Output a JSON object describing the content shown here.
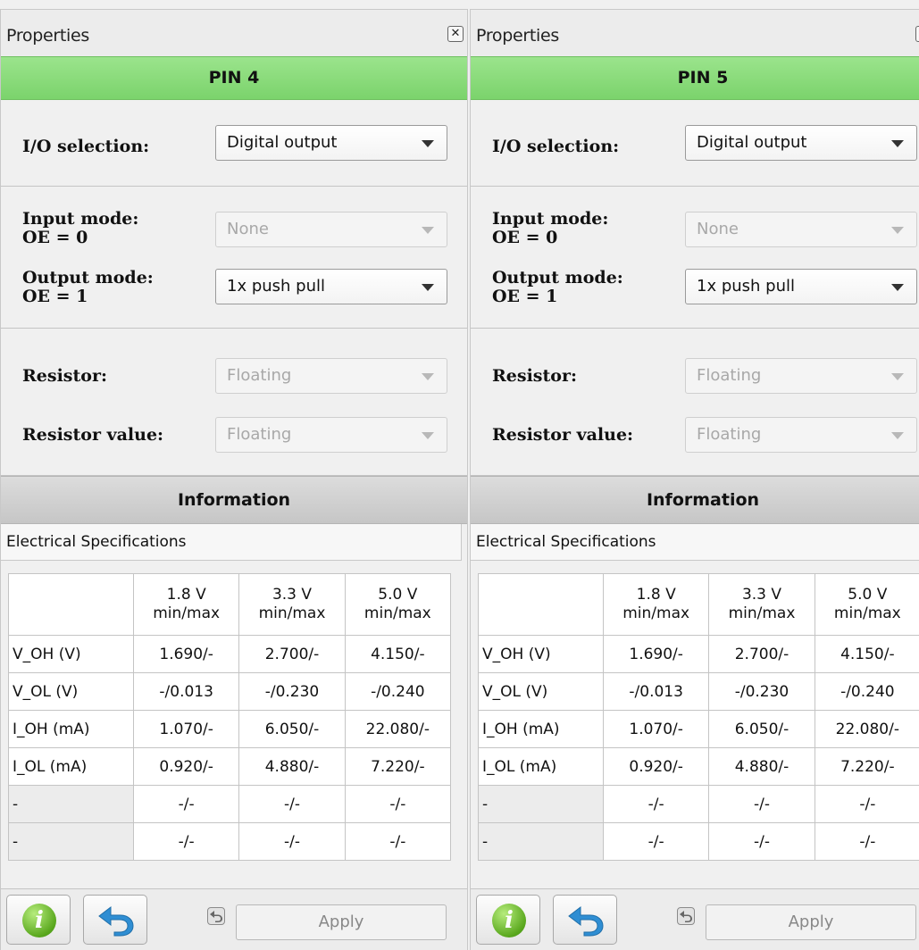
{
  "colors": {
    "pin_header": "#86da76",
    "info_header": "#d0d0d0",
    "info_icon": "#5aa81e",
    "undo_icon": "#2f8ed3"
  },
  "panels": [
    {
      "title": "Properties",
      "close_glyph": "✕",
      "pin": "PIN 4",
      "io_label": "I/O selection:",
      "io_value": "Digital output",
      "input_mode_label_1": "Input mode:",
      "input_mode_label_2": "OE = 0",
      "input_mode_value": "None",
      "output_mode_label_1": "Output mode:",
      "output_mode_label_2": "OE = 1",
      "output_mode_value": "1x push pull",
      "resistor_label": "Resistor:",
      "resistor_value": "Floating",
      "resistor_value_label": "Resistor value:",
      "resistor_value_value": "Floating",
      "info_header": "Information",
      "spec_title": "Electrical Specifications",
      "apply_label": "Apply"
    },
    {
      "title": "Properties",
      "close_glyph": "✕",
      "pin": "PIN 5",
      "io_label": "I/O selection:",
      "io_value": "Digital output",
      "input_mode_label_1": "Input mode:",
      "input_mode_label_2": "OE = 0",
      "input_mode_value": "None",
      "output_mode_label_1": "Output mode:",
      "output_mode_label_2": "OE = 1",
      "output_mode_value": "1x push pull",
      "resistor_label": "Resistor:",
      "resistor_value": "Floating",
      "resistor_value_label": "Resistor value:",
      "resistor_value_value": "Floating",
      "info_header": "Information",
      "spec_title": "Electrical Specifications",
      "apply_label": "Apply"
    }
  ],
  "table": {
    "columns": [
      {
        "v": "1.8 V",
        "unit": "min/max"
      },
      {
        "v": "3.3 V",
        "unit": "min/max"
      },
      {
        "v": "5.0 V",
        "unit": "min/max"
      }
    ],
    "rows": [
      {
        "label": "V_OH (V)",
        "cells": [
          "1.690/-",
          "2.700/-",
          "4.150/-"
        ]
      },
      {
        "label": "V_OL (V)",
        "cells": [
          "-/0.013",
          "-/0.230",
          "-/0.240"
        ]
      },
      {
        "label": "I_OH (mA)",
        "cells": [
          "1.070/-",
          "6.050/-",
          "22.080/-"
        ]
      },
      {
        "label": "I_OL (mA)",
        "cells": [
          "0.920/-",
          "4.880/-",
          "7.220/-"
        ]
      },
      {
        "label": "-",
        "cells": [
          "-/-",
          "-/-",
          "-/-"
        ]
      },
      {
        "label": "-",
        "cells": [
          "-/-",
          "-/-",
          "-/-"
        ]
      }
    ]
  }
}
